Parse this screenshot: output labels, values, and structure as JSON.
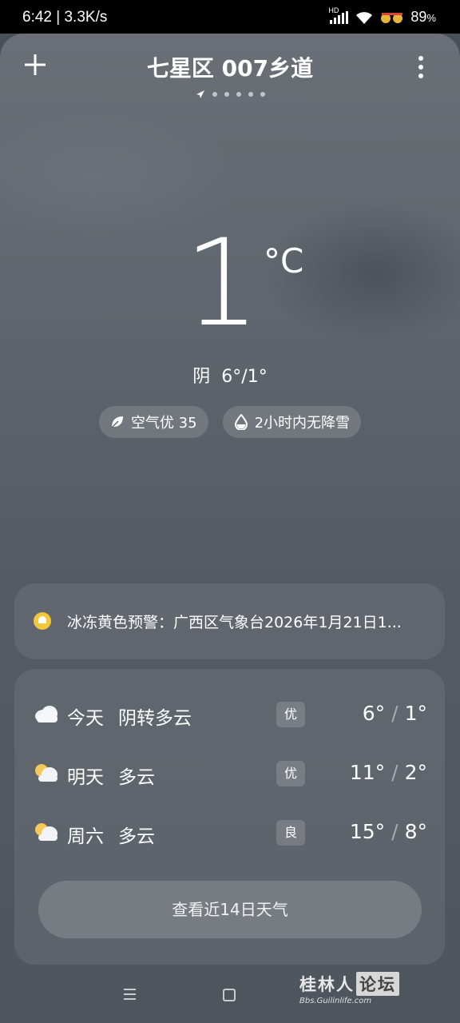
{
  "status_bar": {
    "time": "6:42",
    "speed": "3.3K/s",
    "network_badge": "HD",
    "battery": "89",
    "battery_unit": "%"
  },
  "header": {
    "add_icon": "plus-icon",
    "title": "七星区 007乡道",
    "more_icon": "more-vertical-icon",
    "page_count": 6
  },
  "current": {
    "temperature": "1",
    "unit": "°C",
    "condition": "阴",
    "high_low": "6°/1°"
  },
  "chips": {
    "air": "空气优 35",
    "precip": "2小时内无降雪"
  },
  "alert": {
    "text": "冰冻黄色预警：广西区气象台2026年1月21日1...",
    "color": "#f2c83a"
  },
  "forecast": {
    "rows": [
      {
        "day": "今天",
        "desc": "阴转多云",
        "aqi": "优",
        "high": "6°",
        "sep": "/",
        "low": "1°",
        "icon": "cloudy-icon"
      },
      {
        "day": "明天",
        "desc": "多云",
        "aqi": "优",
        "high": "11°",
        "sep": "/",
        "low": "2°",
        "icon": "partly-cloudy-icon"
      },
      {
        "day": "周六",
        "desc": "多云",
        "aqi": "良",
        "high": "15°",
        "sep": "/",
        "low": "8°",
        "icon": "partly-cloudy-icon"
      }
    ],
    "button": "查看近14日天气"
  },
  "watermark": {
    "main": "桂林人",
    "boxed": "论坛",
    "sub": "Bbs.Guilinlife.com"
  }
}
